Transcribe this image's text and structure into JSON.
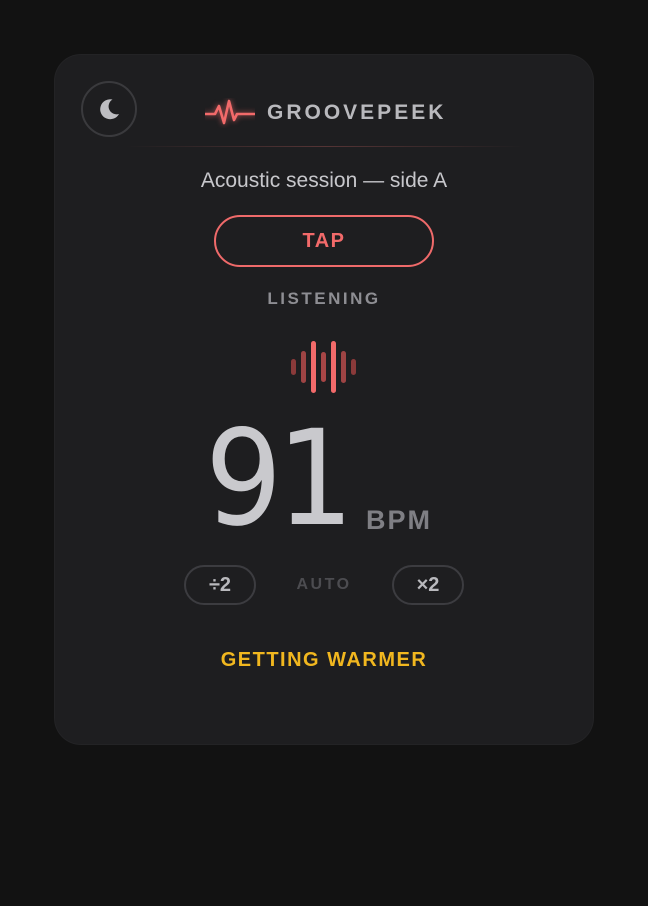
{
  "app": {
    "name": "GROOVEPEEK",
    "accent_color": "#f26a6a",
    "hint_color": "#f1b71f"
  },
  "header": {
    "theme_icon": "moon-icon",
    "brand_icon": "heartbeat-icon"
  },
  "session": {
    "title": "Acoustic session — side A"
  },
  "tap": {
    "label": "TAP"
  },
  "status": {
    "label": "LISTENING",
    "indicator_icon": "sound-wave-icon"
  },
  "tempo": {
    "value": "91",
    "unit": "BPM"
  },
  "controls": {
    "half_label": "÷2",
    "mode_label": "AUTO",
    "double_label": "×2"
  },
  "feedback": {
    "hint": "GETTING WARMER"
  }
}
